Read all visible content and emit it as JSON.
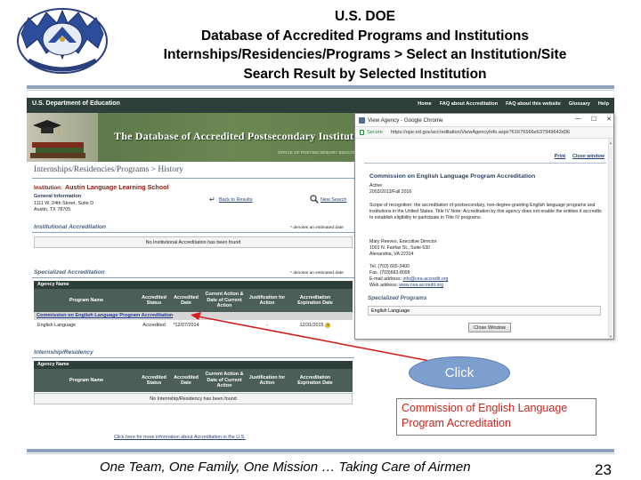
{
  "slide": {
    "title_lines": [
      "U.S. DOE",
      "Database of Accredited Programs and Institutions",
      "Internships/Residencies/Programs > Select an Institution/Site",
      "Search Result by Selected Institution"
    ],
    "footer": "One Team, One Family, One Mission … Taking Care of Airmen",
    "page_number": "23"
  },
  "site": {
    "department": "U.S. Department of Education",
    "nav": [
      "Home",
      "FAQ about Accreditation",
      "FAQ about this website",
      "Glossary",
      "Help"
    ],
    "banner_title": "The Database of Accredited Postsecondary Institutions and Programs",
    "banner_sub": "OFFICE OF POSTSECONDARY EDUCATION"
  },
  "page": {
    "heading": "Internships/Residencies/Programs > History",
    "institution_label": "Institution:",
    "institution_name": "Austin Language Learning School",
    "general_info_head": "General Information",
    "address_lines": [
      "1111 W. 24th Street, Suite D",
      "Austin, TX  78705"
    ],
    "back_link": "Back to Results",
    "new_search": "New Search",
    "inst_accred_head": "Institutional Accreditation",
    "est_note": "* denotes an estimated date",
    "no_inst_accred": "No Institutional Accreditation has been found",
    "spec_accred_head": "Specialized Accreditation",
    "agency_name_col": "Agency Name",
    "columns": [
      "Program Name",
      "Accredited Status",
      "Accredited Date",
      "Current Action & Date of Current Action",
      "Justification for Action",
      "Accreditation Expiration Date"
    ],
    "commission_row": "Commission on English Language Program Accreditation",
    "program_row": {
      "name": "English Language",
      "status": "Accredited",
      "date": "*12/07/2014",
      "action": "",
      "justification": "-",
      "expiration": "12/31/2015"
    },
    "internship_head": "Internship/Residency",
    "no_internship": "No Internship/Residency has been found",
    "more_info_link": "Click here for more information about Accreditation in the U.S."
  },
  "popup": {
    "window_title": "View Agency - Google Chrome",
    "window_buttons": [
      "—",
      "☐",
      "✕"
    ],
    "secure": "Secure",
    "url": "https://ope.ed.gov/accreditation/ViewAgencyInfo.aspx?61676566e637949643d36",
    "print_link": "Print",
    "close_link": "Close window",
    "agency_title": "Commission on English Language Program Accreditation",
    "status": "Active",
    "years": "2003/2013/Fall 2016",
    "scope": "Scope of recognition: the accreditation of postsecondary, non-degree-granting English language programs and institutions in the United States. Title IV Note: Accreditation by this agency does not enable the entities it accredits to establish eligibility to participate in Title IV programs.",
    "contact_lines": [
      "Mary Reeves, Executive Director",
      "1001 N. Fairfax St., Suite 630",
      "Alexandria, VA 22314"
    ],
    "tel": "Tel. (703) 665-3400",
    "fax": "Fax. (703)683-8099",
    "email_label": "E-mail address:",
    "email": "info@cea-accredit.org",
    "web_label": "Web address:",
    "web": "www.cea-accredit.org",
    "specialized_head": "Specialized Programs",
    "specialized_item": "English Language",
    "close_button": "Close Window"
  },
  "callout": {
    "click_label": "Click",
    "note": "Commission of English Language Program Accreditation"
  },
  "colors": {
    "ed_bar": "#2d3e3b",
    "callout_red": "#c5271f",
    "bubble_blue": "#7c9fcf",
    "rule_blue": "#8ea3bd"
  }
}
